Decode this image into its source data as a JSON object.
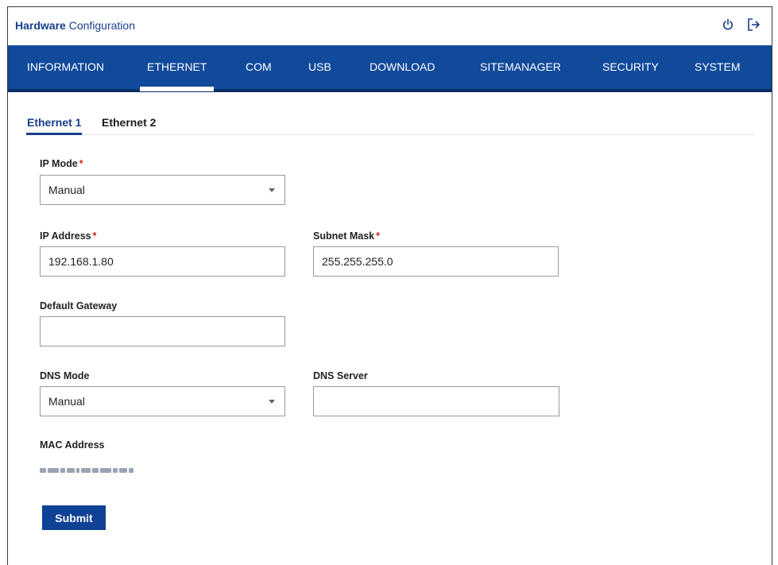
{
  "header": {
    "title_bold": "Hardware",
    "title_rest": "Configuration",
    "icons": [
      "power-icon",
      "logout-icon"
    ]
  },
  "nav": {
    "items": [
      "INFORMATION",
      "ETHERNET",
      "COM",
      "USB",
      "DOWNLOAD",
      "SITEMANAGER",
      "SECURITY",
      "SYSTEM"
    ],
    "active": "ETHERNET"
  },
  "subtabs": {
    "items": [
      "Ethernet 1",
      "Ethernet 2"
    ],
    "active": "Ethernet 1"
  },
  "form": {
    "ip_mode": {
      "label": "IP Mode",
      "required_mark": "*",
      "value": "Manual"
    },
    "ip_address": {
      "label": "IP Address",
      "required_mark": "*",
      "value": "192.168.1.80"
    },
    "subnet_mask": {
      "label": "Subnet Mask",
      "required_mark": "*",
      "value": "255.255.255.0"
    },
    "default_gateway": {
      "label": "Default Gateway",
      "value": ""
    },
    "dns_mode": {
      "label": "DNS Mode",
      "value": "Manual"
    },
    "dns_server": {
      "label": "DNS Server",
      "value": ""
    },
    "mac_address": {
      "label": "MAC Address"
    },
    "submit_label": "Submit"
  },
  "colors": {
    "brand": "#11499b",
    "nav_border": "#0b2f66",
    "title": "#173f8a",
    "required": "#cc1f1f",
    "button": "#0f4194"
  }
}
